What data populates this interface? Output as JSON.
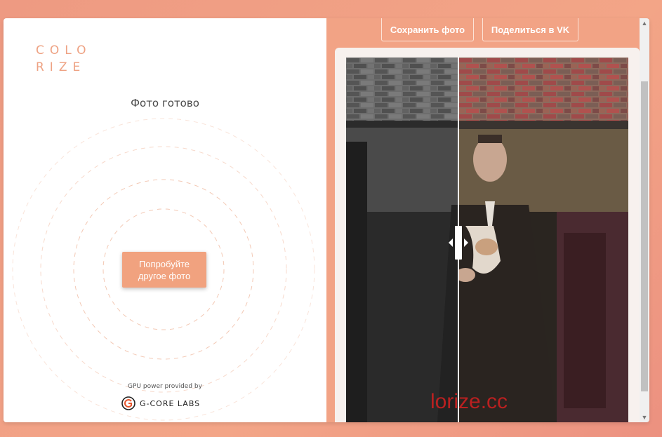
{
  "logo": {
    "line1": "COLO",
    "line2": "RIZE"
  },
  "status": "Фото готово",
  "try_button": {
    "line1": "Попробуйте",
    "line2": "другое фото"
  },
  "footer": {
    "gpu_text": "GPU power provided by",
    "sponsor": "G-CORE LABS"
  },
  "toolbar": {
    "save_label": "Сохранить фото",
    "share_label": "Поделиться в VK"
  },
  "photo": {
    "watermark": "lorize.cc",
    "slider_position_percent": 40
  },
  "colors": {
    "accent": "#f1a27f",
    "logo": "#eea283",
    "background": "#f2a385"
  }
}
